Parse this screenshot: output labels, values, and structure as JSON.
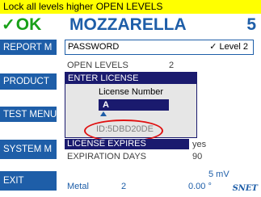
{
  "header": {
    "warning": "Lock all levels higher OPEN LEVELS",
    "status": "OK",
    "status_icon": "checkmark-icon",
    "product": "MOZZARELLA",
    "channel": "5"
  },
  "sidebar": {
    "items": [
      {
        "label": "REPORT M"
      },
      {
        "label": "PRODUCT"
      },
      {
        "label": "TEST MENU"
      },
      {
        "label": "SYSTEM M"
      },
      {
        "label": "EXIT"
      }
    ]
  },
  "password": {
    "label": "PASSWORD",
    "level_check": "✓",
    "level": "Level 2"
  },
  "open_levels": {
    "label": "OPEN LEVELS",
    "value": "2"
  },
  "dialog": {
    "title": "ENTER LICENSE",
    "license_label": "License Number",
    "license_value": "A",
    "id": "ID:5DBD20DE"
  },
  "license_expires": {
    "label": "LICENSE EXPIRES",
    "value": "yes"
  },
  "expiration_days": {
    "label": "EXPIRATION DAYS",
    "value": "90"
  },
  "measurement": {
    "signal": "5 mV",
    "metal_label": "Metal",
    "metal_value": "2",
    "angle": "0.00 °"
  },
  "brand": "SNET",
  "colors": {
    "warning_bar": "#ffff00",
    "accent": "#1e5ea8",
    "ok": "#18a018",
    "dialog_title": "#1a1a6e",
    "highlight": "#e01010"
  }
}
